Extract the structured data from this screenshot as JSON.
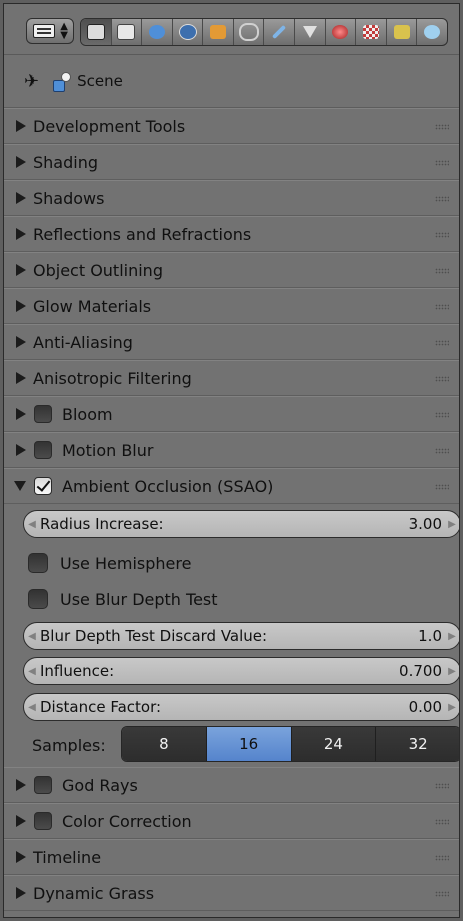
{
  "scene": {
    "label": "Scene",
    "icon": "scene-icon"
  },
  "panels_top": [
    {
      "label": "Development Tools"
    },
    {
      "label": "Shading"
    },
    {
      "label": "Shadows"
    },
    {
      "label": "Reflections and Refractions"
    },
    {
      "label": "Object Outlining"
    },
    {
      "label": "Glow Materials"
    },
    {
      "label": "Anti-Aliasing"
    },
    {
      "label": "Anisotropic Filtering"
    },
    {
      "label": "Bloom",
      "checked": false
    },
    {
      "label": "Motion Blur",
      "checked": false
    }
  ],
  "ssao": {
    "label": "Ambient Occlusion (SSAO)",
    "checked": true,
    "radius_increase": {
      "label": "Radius Increase:",
      "value": "3.00"
    },
    "use_hemisphere": {
      "label": "Use Hemisphere",
      "checked": false
    },
    "use_blur_depth_test": {
      "label": "Use Blur Depth Test",
      "checked": false
    },
    "blur_discard": {
      "label": "Blur Depth Test Discard Value:",
      "value": "1.0"
    },
    "influence": {
      "label": "Influence:",
      "value": "0.700"
    },
    "distance_factor": {
      "label": "Distance Factor:",
      "value": "0.00"
    },
    "samples": {
      "label": "Samples:",
      "options": [
        "8",
        "16",
        "24",
        "32"
      ],
      "selected": "16"
    }
  },
  "panels_bottom": [
    {
      "label": "God Rays",
      "checked": false
    },
    {
      "label": "Color Correction",
      "checked": false
    },
    {
      "label": "Timeline"
    },
    {
      "label": "Dynamic Grass"
    }
  ],
  "colors": {
    "accent": "#5a88cf",
    "panel_bg": "#727272",
    "field_bg": "#bfbfbf"
  }
}
